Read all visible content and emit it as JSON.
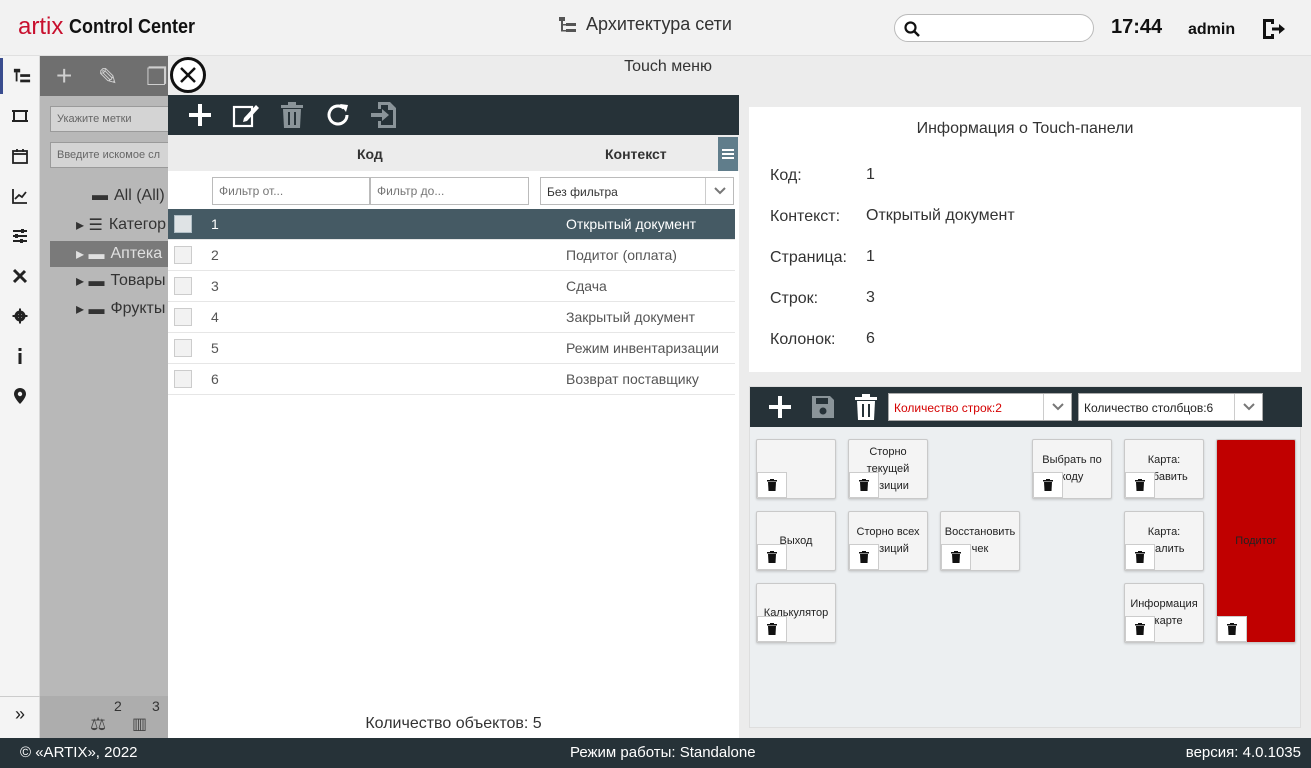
{
  "header": {
    "logo_brand": "artix",
    "logo_product": "Control Center",
    "title": "Архитектура сети",
    "search_placeholder": "",
    "time": "17:44",
    "user": "admin"
  },
  "rail": [
    "tree-icon",
    "frame-icon",
    "calendar-icon",
    "chart-icon",
    "sliders-icon",
    "tools-icon",
    "gear-icon",
    "info-icon",
    "map-pin-icon"
  ],
  "background_panel": {
    "tags_placeholder": "Укажите метки",
    "search_placeholder": "Введите искомое сл",
    "tree": [
      {
        "label": "All (All)"
      },
      {
        "label": "Категор"
      },
      {
        "label": "Аптека"
      },
      {
        "label": "Товары"
      },
      {
        "label": "Фрукты"
      }
    ],
    "footer_counts": [
      "2",
      "3"
    ]
  },
  "modal": {
    "title": "Touch меню",
    "table": {
      "col_code": "Код",
      "col_context": "Контекст",
      "filter_from": "Фильтр от...",
      "filter_to": "Фильтр до...",
      "filter_select": "Без фильтра",
      "rows": [
        {
          "code": "1",
          "context": "Открытый документ"
        },
        {
          "code": "2",
          "context": "Подитог (оплата)"
        },
        {
          "code": "3",
          "context": "Сдача"
        },
        {
          "code": "4",
          "context": "Закрытый документ"
        },
        {
          "code": "5",
          "context": "Режим инвентаризации"
        },
        {
          "code": "6",
          "context": "Возврат поставщику"
        }
      ],
      "count_label": "Количество объектов: 5"
    },
    "info": {
      "title": "Информация о Touch-панели",
      "code_label": "Код:",
      "code_value": "1",
      "context_label": "Контекст:",
      "context_value": "Открытый документ",
      "page_label": "Страница:",
      "page_value": "1",
      "rows_label": "Строк:",
      "rows_value": "3",
      "cols_label": "Колонок:",
      "cols_value": "6"
    },
    "grid": {
      "rows_select": "Количество строк:2",
      "cols_select": "Количество столбцов:6",
      "tiles": [
        {
          "label": ""
        },
        {
          "label": "Сторно текущей позиции"
        },
        {
          "label": "Выбрать по коду"
        },
        {
          "label": "Карта: добавить"
        },
        {
          "label": "Подитог"
        },
        {
          "label": "Выход"
        },
        {
          "label": "Сторно всех позиций"
        },
        {
          "label": "Восстановить чек"
        },
        {
          "label": "Карта: удалить"
        },
        {
          "label": "Калькулятор"
        },
        {
          "label": "Информация о карте"
        }
      ]
    }
  },
  "footer": {
    "copyright": "© «ARTIX», 2022",
    "mode": "Режим работы: Standalone",
    "version": "версия: 4.0.1035"
  },
  "colors": {
    "dark_toolbar": "#263238",
    "selected_row": "#455a64",
    "brand_red": "#c8102e",
    "tile_red": "#c00000"
  }
}
